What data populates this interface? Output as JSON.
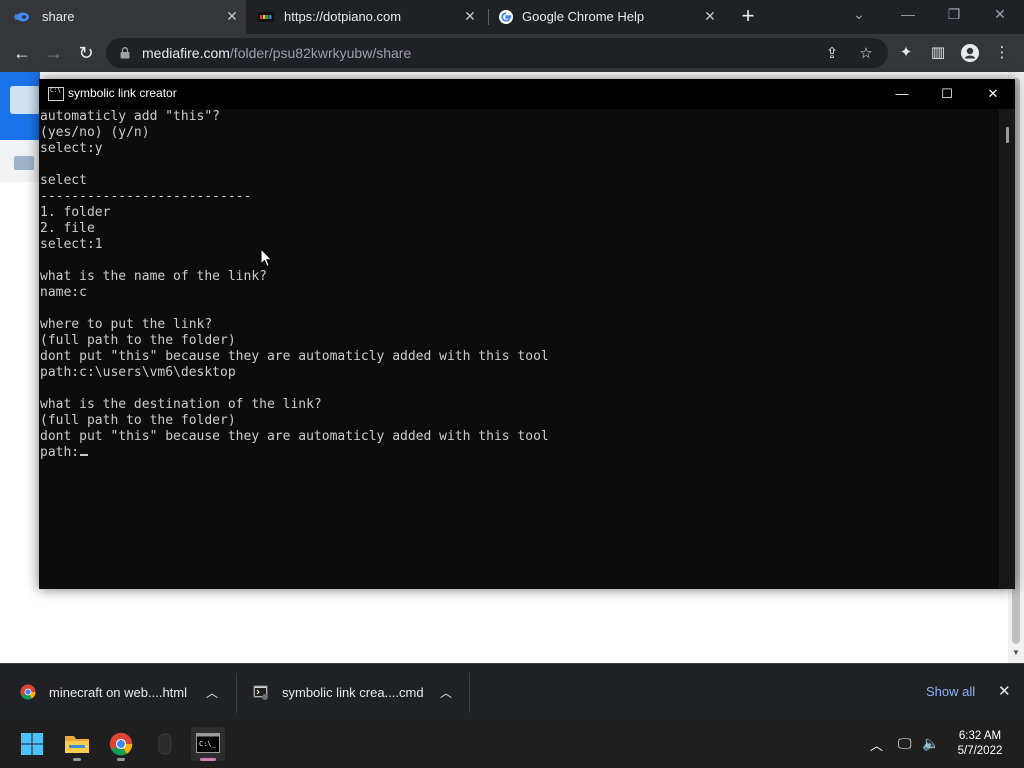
{
  "browser": {
    "tabs": [
      {
        "title": "share",
        "favicon": "mediafire-icon",
        "active": true
      },
      {
        "title": "https://dotpiano.com",
        "favicon": "dotpiano-icon",
        "active": false
      },
      {
        "title": "Google Chrome Help",
        "favicon": "google-icon",
        "active": false
      }
    ],
    "new_tab_glyph": "+",
    "url_host": "mediafire.com",
    "url_path": "/folder/psu82kwrkyubw/share"
  },
  "console": {
    "title": "symbolic link creator",
    "lines": [
      "automaticly add \"this\"?",
      "(yes/no) (y/n)",
      "select:y",
      "",
      "select",
      "---------------------------",
      "1. folder",
      "2. file",
      "select:1",
      "",
      "what is the name of the link?",
      "name:c",
      "",
      "where to put the link?",
      "(full path to the folder)",
      "dont put \"this\" because they are automaticly added with this tool",
      "path:c:\\users\\vm6\\desktop",
      "",
      "what is the destination of the link?",
      "(full path to the folder)",
      "dont put \"this\" because they are automaticly added with this tool"
    ],
    "prompt": "path:"
  },
  "downloads": {
    "items": [
      {
        "name": "minecraft on web....html",
        "icon": "chrome-icon"
      },
      {
        "name": "symbolic link crea....cmd",
        "icon": "cmd-file-icon"
      }
    ],
    "show_all": "Show all"
  },
  "taskbar": {
    "apps": [
      "start-icon",
      "file-explorer-icon",
      "chrome-icon",
      "mouse-app-icon",
      "terminal-icon"
    ],
    "clock_time": "6:32 AM",
    "clock_date": "5/7/2022"
  },
  "colors": {
    "console_bg": "#0c0c0c",
    "console_text": "#cccccc",
    "chrome_dark": "#202124",
    "accent_link": "#8ab4f8",
    "mediafire_blue": "#1a73e8"
  }
}
